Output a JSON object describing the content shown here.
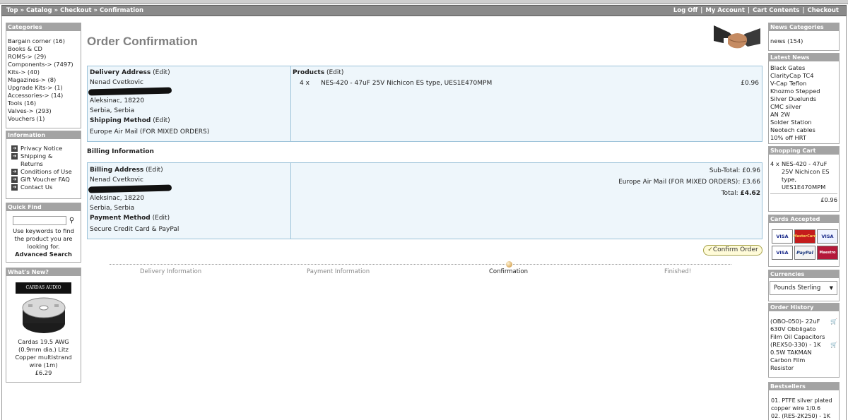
{
  "breadcrumb": {
    "items": [
      "Top",
      "Catalog",
      "Checkout",
      "Confirmation"
    ],
    "separator": "»"
  },
  "header_links": [
    "Log Off",
    "My Account",
    "Cart Contents",
    "Checkout"
  ],
  "left": {
    "categories": {
      "title": "Categories",
      "items": [
        "Bargain corner (16)",
        "Books & CD",
        "ROMS-> (29)",
        "Components-> (7497)",
        "Kits-> (40)",
        "Magazines-> (8)",
        "Upgrade Kits-> (1)",
        "Accessories-> (14)",
        "Tools (16)",
        "Valves-> (293)",
        "Vouchers (1)"
      ]
    },
    "information": {
      "title": "Information",
      "items": [
        "Privacy Notice",
        "Shipping & Returns",
        "Conditions of Use",
        "Gift Voucher FAQ",
        "Contact Us"
      ]
    },
    "quick_find": {
      "title": "Quick Find",
      "input_value": "",
      "help": "Use keywords to find the product you are looking for.",
      "advanced": "Advanced Search"
    },
    "whats_new": {
      "title": "What's New?",
      "brand": "CARDAS AUDIO",
      "product": "Cardas 19.5 AWG (0.9mm dia.) Litz Copper multistrand wire (1m)",
      "price": "£6.29"
    }
  },
  "main": {
    "title": "Order Confirmation",
    "delivery": {
      "heading": "Delivery Address",
      "edit": "(Edit)",
      "name": "Nenad Cvetkovic",
      "city": "Aleksinac, 18220",
      "country": "Serbia, Serbia",
      "shipping_heading": "Shipping Method",
      "shipping_edit": "(Edit)",
      "shipping_value": "Europe Air Mail (FOR MIXED ORDERS)"
    },
    "products": {
      "heading": "Products",
      "edit": "(Edit)",
      "items": [
        {
          "qty": "4 x",
          "name": "NES-420 - 47uF 25V Nichicon ES type, UES1E470MPM",
          "price": "£0.96"
        }
      ]
    },
    "billing_info_title": "Billing Information",
    "billing": {
      "heading": "Billing Address",
      "edit": "(Edit)",
      "name": "Nenad Cvetkovic",
      "city": "Aleksinac, 18220",
      "country": "Serbia, Serbia",
      "payment_heading": "Payment Method",
      "payment_edit": "(Edit)",
      "payment_value": "Secure Credit Card & PayPal"
    },
    "totals": [
      {
        "label": "Sub-Total:",
        "value": "£0.96",
        "bold": false
      },
      {
        "label": "Europe Air Mail (FOR MIXED ORDERS):",
        "value": "£3.66",
        "bold": false
      },
      {
        "label": "Total:",
        "value": "£4.62",
        "bold": true
      }
    ],
    "confirm_button": "Confirm Order",
    "steps": [
      "Delivery Information",
      "Payment Information",
      "Confirmation",
      "Finished!"
    ]
  },
  "right": {
    "news_categories": {
      "title": "News Categories",
      "items": [
        "news (154)"
      ]
    },
    "latest_news": {
      "title": "Latest News",
      "items": [
        "Black Gates",
        "ClarityCap TC4",
        "V-Cap Teflon",
        "Khozmo Stepped",
        "Silver Duelunds",
        "CMC silver",
        "AN 2W",
        "Solder Station",
        "Neotech cables",
        "10% off HRT"
      ]
    },
    "shopping_cart": {
      "title": "Shopping Cart",
      "qty": "4 x",
      "item": "NES-420 - 47uF 25V Nichicon ES type, UES1E470MPM",
      "total": "£0.96"
    },
    "cards": {
      "title": "Cards Accepted",
      "items": [
        "VISA",
        "MasterCard",
        "VISA",
        "VISA",
        "PayPal",
        "Maestro"
      ]
    },
    "currencies": {
      "title": "Currencies",
      "selected": "Pounds Sterling"
    },
    "order_history": {
      "title": "Order History",
      "items": [
        "(OBO-050)- 22uF 630V Obbligato Film Oil Capacitors",
        "(REX50-330) - 1K 0.5W TAKMAN Carbon Film Resistor"
      ]
    },
    "bestsellers": {
      "title": "Bestsellers",
      "items": [
        "01. PTFE silver plated copper wire 1/0.6",
        "02. (RES-2K250) - 1K"
      ]
    }
  }
}
